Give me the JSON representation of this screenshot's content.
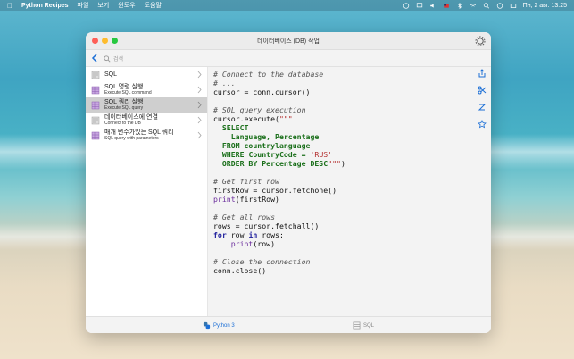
{
  "menubar": {
    "app_name": "Python Recipes",
    "menus": [
      "파일",
      "보기",
      "윈도우",
      "도움말"
    ],
    "clock": "Пн, 2 авг.  13:25"
  },
  "window": {
    "title": "데이터베이스 (DB) 작업"
  },
  "search": {
    "placeholder": "검색"
  },
  "sidebar": {
    "items": [
      {
        "title": "SQL",
        "subtitle": ""
      },
      {
        "title": "SQL 명령 실행",
        "subtitle": "Execute SQL command"
      },
      {
        "title": "SQL 쿼리 실행",
        "subtitle": "Execute SQL query",
        "selected": true
      },
      {
        "title": "데이터베이스에 연결",
        "subtitle": "Connect to the DB"
      },
      {
        "title": "매개 변수가있는 SQL 쿼리",
        "subtitle": "SQL query with parameters"
      }
    ]
  },
  "code": {
    "l1": "# Connect to the database",
    "l2": "# ...",
    "l3": "cursor = conn.cursor()",
    "l5": "# SQL query execution",
    "l6a": "cursor.execute(",
    "l6b": "\"\"\"",
    "l7": "  SELECT",
    "l8": "    Language, Percentage",
    "l9a": "  FROM",
    "l9b": " countrylanguage",
    "l10a": "  WHERE",
    "l10b": " CountryCode = ",
    "l10c": "'RUS'",
    "l11a": "  ORDER BY",
    "l11b": " Percentage ",
    "l11c": "DESC",
    "l11d": "\"\"\"",
    "l11e": ")",
    "l13": "# Get first row",
    "l14": "firstRow = cursor.fetchone()",
    "l15a": "print",
    "l15b": "(firstRow)",
    "l17": "# Get all rows",
    "l18": "rows = cursor.fetchall()",
    "l19a": "for",
    "l19b": " row ",
    "l19c": "in",
    "l19d": " rows:",
    "l20a": "    print",
    "l20b": "(row)",
    "l22": "# Close the connection",
    "l23": "conn.close()"
  },
  "bottom_tabs": {
    "python": "Python 3",
    "sql": "SQL"
  },
  "colors": {
    "accent": "#1c6fd6",
    "selected_row": "#cfcfcf"
  }
}
